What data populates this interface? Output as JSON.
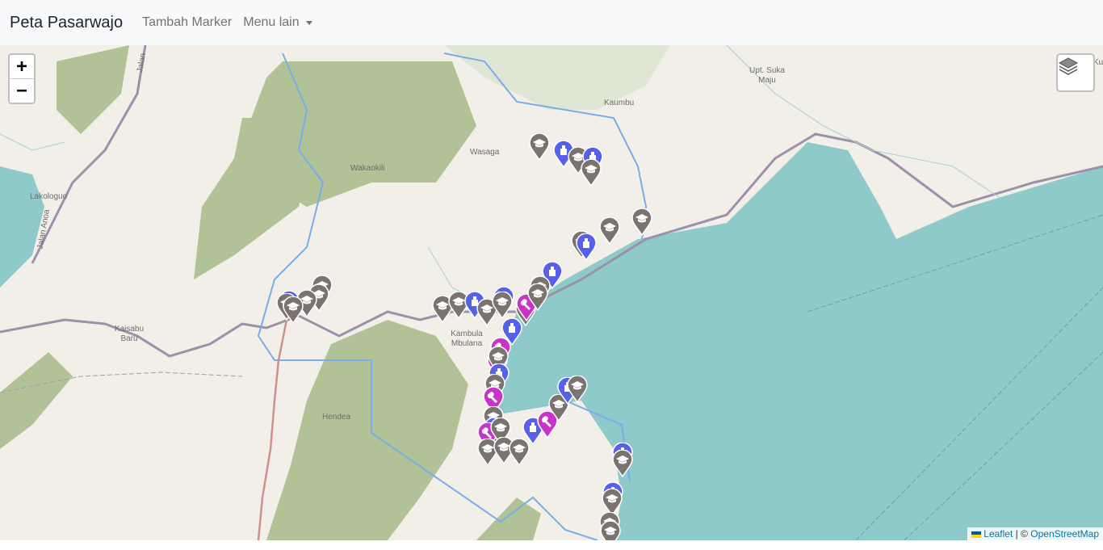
{
  "navbar": {
    "brand": "Peta Pasarwajo",
    "links": [
      "Tambah Marker",
      "Menu lain"
    ]
  },
  "map": {
    "zoom_in": "+",
    "zoom_out": "−",
    "layers_icon": "layers-icon",
    "attribution": {
      "leaflet": "Leaflet",
      "separator": " | © ",
      "osm": "OpenStreetMap"
    },
    "places": [
      "Upt. Suka Maju",
      "Kaumbu",
      "Wasaga",
      "Wakaokili",
      "Lakologuo",
      "Jalan Anoa",
      "Jalan",
      "Kaisabu Baru",
      "Kambula Mbulana",
      "Hendea",
      "Ku"
    ],
    "marker_types": {
      "school": {
        "color": "#7a7370",
        "icon": "graduation-cap-icon"
      },
      "worship": {
        "color": "#5660e8",
        "icon": "mosque-icon"
      },
      "health": {
        "color": "#c734c7",
        "icon": "wrench-icon"
      }
    },
    "colors": {
      "land": "#f2efe9",
      "sea": "#8fcacb",
      "forest": "#b1c296",
      "boundary": "#79adeb",
      "admin": "#9b91a8"
    }
  }
}
